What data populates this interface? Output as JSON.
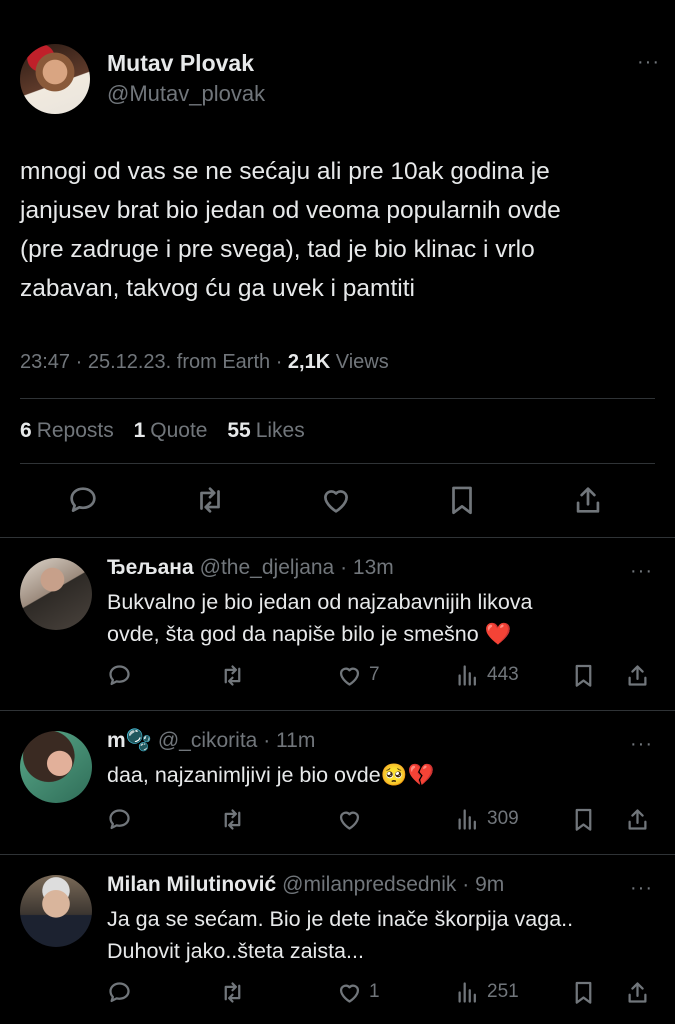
{
  "tweet": {
    "author_name": "Mutav Plovak",
    "author_handle": "@Mutav_plovak",
    "more": "···",
    "text_lines": [
      "mnogi od vas se ne sećaju ali pre 10ak godina je",
      "janjusev brat bio jedan od veoma popularnih ovde",
      "(pre zadruge i pre svega), tad je bio klinac i vrlo",
      "zabavan, takvog ću ga uvek i pamtiti"
    ],
    "meta_time": "23:47 · 25.12.23. from Earth · ",
    "views_count": "2,1K",
    "views_label": " Views",
    "reposts_count": "6",
    "reposts_label": "Reposts",
    "quotes_count": "1",
    "quotes_label": "Quote",
    "likes_count": "55",
    "likes_label": "Likes"
  },
  "replies": [
    {
      "name": "Ђељана",
      "handle": "@the_djeljana · 13m",
      "text_lines": [
        "Bukvalno je bio jedan od najzabavnijih likova",
        "ovde, šta god da napiše bilo je smešno"
      ],
      "emoji": "❤️",
      "likes": "7",
      "views": "443"
    },
    {
      "name": "m",
      "name_emoji": "🫧",
      "handle": "@_cikorita · 11m",
      "text_lines": [
        "daa, najzanimljivi je bio ovde"
      ],
      "emoji": "🥺💔",
      "likes": "",
      "views": "309"
    },
    {
      "name": "Milan Milutinović",
      "handle": "@milanpredsednik · 9m",
      "text_lines": [
        "Ja ga se sećam. Bio je dete inače škorpija vaga..",
        "Duhovit jako..šteta zaista..."
      ],
      "emoji": "",
      "likes": "1",
      "views": "251"
    }
  ],
  "colors": {
    "background": "#000000",
    "text": "#e7e9ea",
    "muted": "#71767b",
    "divider": "#2f3336",
    "heart": "#f5222d"
  }
}
